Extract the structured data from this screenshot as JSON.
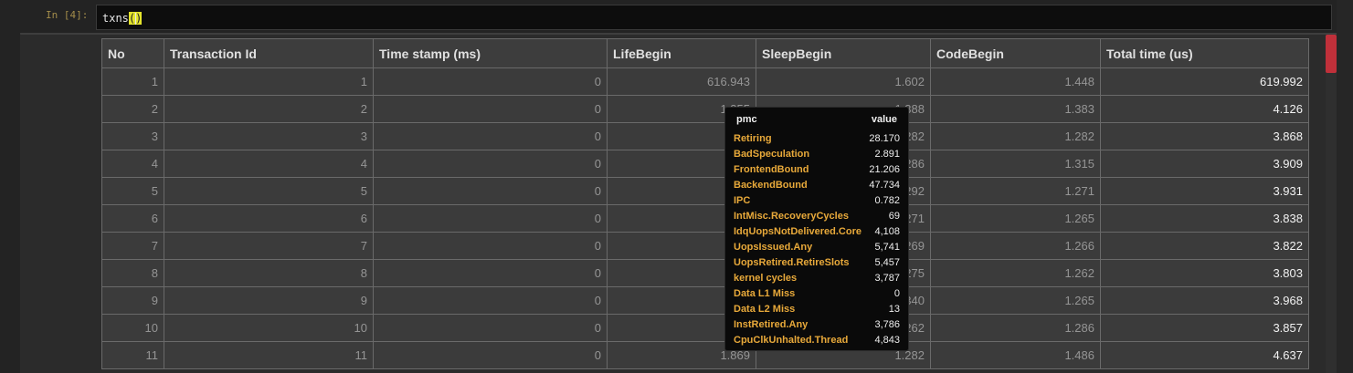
{
  "cell": {
    "prompt": "In [4]:",
    "code_name": "txns",
    "code_parens": "()"
  },
  "table": {
    "columns": [
      "No",
      "Transaction Id",
      "Time stamp (ms)",
      "LifeBegin",
      "SleepBegin",
      "CodeBegin",
      "Total time (us)"
    ],
    "rows": [
      [
        "1",
        "1",
        "0",
        "616.943",
        "1.602",
        "1.448",
        "619.992"
      ],
      [
        "2",
        "2",
        "0",
        "1.355",
        "1.388",
        "1.383",
        "4.126"
      ],
      [
        "3",
        "3",
        "0",
        "1",
        "1.282",
        "1.282",
        "3.868"
      ],
      [
        "4",
        "4",
        "0",
        "1",
        "1.286",
        "1.315",
        "3.909"
      ],
      [
        "5",
        "5",
        "0",
        "1",
        "1.292",
        "1.271",
        "3.931"
      ],
      [
        "6",
        "6",
        "0",
        "1",
        "1.271",
        "1.265",
        "3.838"
      ],
      [
        "7",
        "7",
        "0",
        "1",
        "1.269",
        "1.266",
        "3.822"
      ],
      [
        "8",
        "8",
        "0",
        "1",
        "1.275",
        "1.262",
        "3.803"
      ],
      [
        "9",
        "9",
        "0",
        "1",
        "1.340",
        "1.265",
        "3.968"
      ],
      [
        "10",
        "10",
        "0",
        "1",
        "1.262",
        "1.286",
        "3.857"
      ],
      [
        "11",
        "11",
        "0",
        "1.869",
        "1.282",
        "1.486",
        "4.637"
      ]
    ]
  },
  "tooltip": {
    "header_key": "pmc",
    "header_value": "value",
    "rows": [
      {
        "k": "Retiring",
        "v": "28.170"
      },
      {
        "k": "BadSpeculation",
        "v": "2.891"
      },
      {
        "k": "FrontendBound",
        "v": "21.206"
      },
      {
        "k": "BackendBound",
        "v": "47.734"
      },
      {
        "k": "IPC",
        "v": "0.782"
      },
      {
        "k": "IntMisc.RecoveryCycles",
        "v": "69"
      },
      {
        "k": "IdqUopsNotDelivered.Core",
        "v": "4,108"
      },
      {
        "k": "UopsIssued.Any",
        "v": "5,741"
      },
      {
        "k": "UopsRetired.RetireSlots",
        "v": "5,457"
      },
      {
        "k": "kernel cycles",
        "v": "3,787"
      },
      {
        "k": "Data L1 Miss",
        "v": "0"
      },
      {
        "k": "Data L2 Miss",
        "v": "13"
      },
      {
        "k": "InstRetired.Any",
        "v": "3,786"
      },
      {
        "k": "CpuClkUnhalted.Thread",
        "v": "4,843"
      }
    ]
  }
}
